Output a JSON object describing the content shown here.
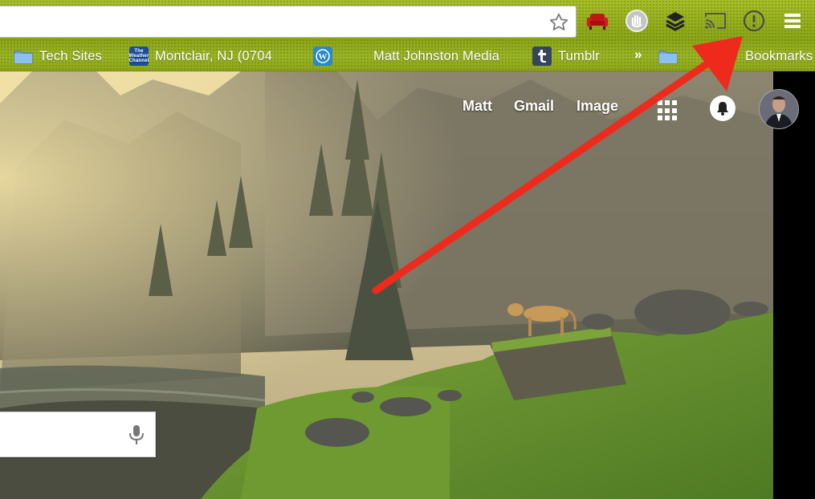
{
  "browser": {
    "omnibox": {
      "value": "",
      "placeholder": ""
    },
    "toolbar_icons": [
      "bookmark-star-icon",
      "couch-extension-icon",
      "hand-extension-icon",
      "buffer-layers-icon",
      "cast-icon",
      "info-circle-icon",
      "chrome-menu-icon"
    ]
  },
  "bookmarks": {
    "items": [
      {
        "label": "Tech Sites",
        "icon": "folder-icon"
      },
      {
        "label": "Montclair, NJ (0704",
        "icon": "weather-channel-icon"
      },
      {
        "label": "",
        "icon": "wordpress-icon"
      },
      {
        "label": "Matt Johnston Media",
        "icon": "none"
      },
      {
        "label": "Tumblr",
        "icon": "tumblr-icon"
      }
    ],
    "overflow": "»",
    "other": {
      "label": "Bookmarks",
      "icon": "folder-icon"
    }
  },
  "google": {
    "links": [
      {
        "label": "Matt"
      },
      {
        "label": "Gmail"
      },
      {
        "label": "Image"
      }
    ],
    "search": {
      "value": "",
      "placeholder": ""
    }
  },
  "colors": {
    "toolbar": "#9ab526",
    "arrow": "#ee2a1c"
  }
}
